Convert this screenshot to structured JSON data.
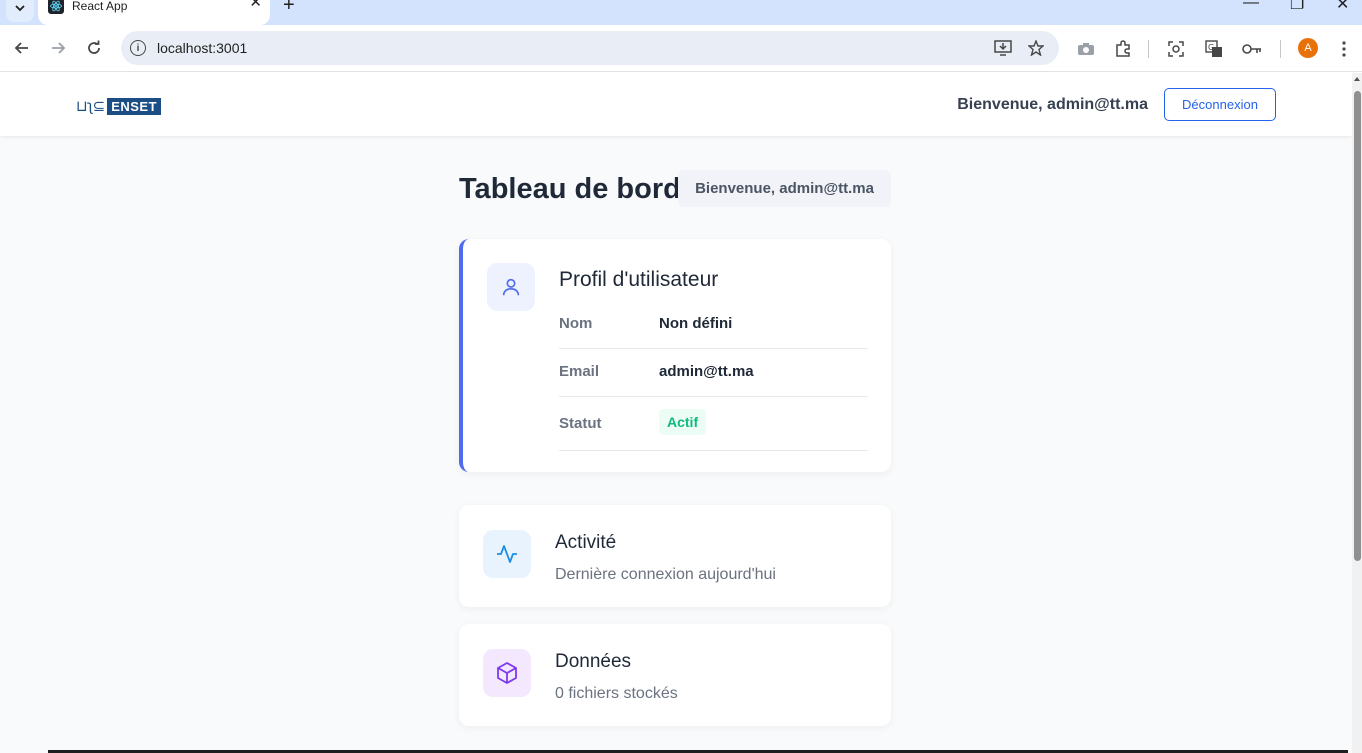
{
  "browser": {
    "tab_title": "React App",
    "url": "localhost:3001",
    "profile_initial": "A"
  },
  "header": {
    "welcome": "Bienvenue, admin@tt.ma",
    "logout_label": "Déconnexion",
    "logo_text": "ENSET"
  },
  "dashboard": {
    "title": "Tableau de bord",
    "welcome_badge": "Bienvenue, admin@tt.ma"
  },
  "profile_card": {
    "title": "Profil d'utilisateur",
    "rows": [
      {
        "label": "Nom",
        "value": "Non défini"
      },
      {
        "label": "Email",
        "value": "admin@tt.ma"
      },
      {
        "label": "Statut",
        "value": "Actif"
      }
    ]
  },
  "activity_card": {
    "title": "Activité",
    "subtitle": "Dernière connexion aujourd'hui"
  },
  "data_card": {
    "title": "Données",
    "subtitle": "0 fichiers stockés"
  },
  "colors": {
    "accent": "#4f6bed",
    "primary_button": "#2563eb",
    "status_active": "#10b981"
  }
}
